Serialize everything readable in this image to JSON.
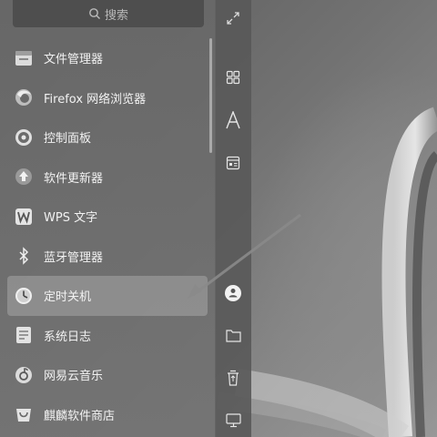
{
  "search": {
    "placeholder": "搜索"
  },
  "apps": [
    {
      "label": "文件管理器",
      "icon": "file-manager-icon"
    },
    {
      "label": "Firefox 网络浏览器",
      "icon": "firefox-icon"
    },
    {
      "label": "控制面板",
      "icon": "control-panel-icon"
    },
    {
      "label": "软件更新器",
      "icon": "software-updater-icon"
    },
    {
      "label": "WPS 文字",
      "icon": "wps-writer-icon"
    },
    {
      "label": "蓝牙管理器",
      "icon": "bluetooth-icon"
    },
    {
      "label": "定时关机",
      "icon": "timed-shutdown-icon",
      "selected": true
    },
    {
      "label": "系统日志",
      "icon": "system-log-icon"
    },
    {
      "label": "网易云音乐",
      "icon": "netease-music-icon"
    },
    {
      "label": "麒麟软件商店",
      "icon": "kylin-store-icon"
    }
  ],
  "sidebar_icons": [
    "expand-icon",
    "all-apps-grid-icon",
    "letter-sort-icon",
    "category-icon",
    "user-icon",
    "folder-icon",
    "trash-icon",
    "computer-icon"
  ],
  "colors": {
    "menu_bg": "#5f5f5f",
    "selected_bg": "#a5a5a5",
    "text": "#f2f2f2"
  }
}
